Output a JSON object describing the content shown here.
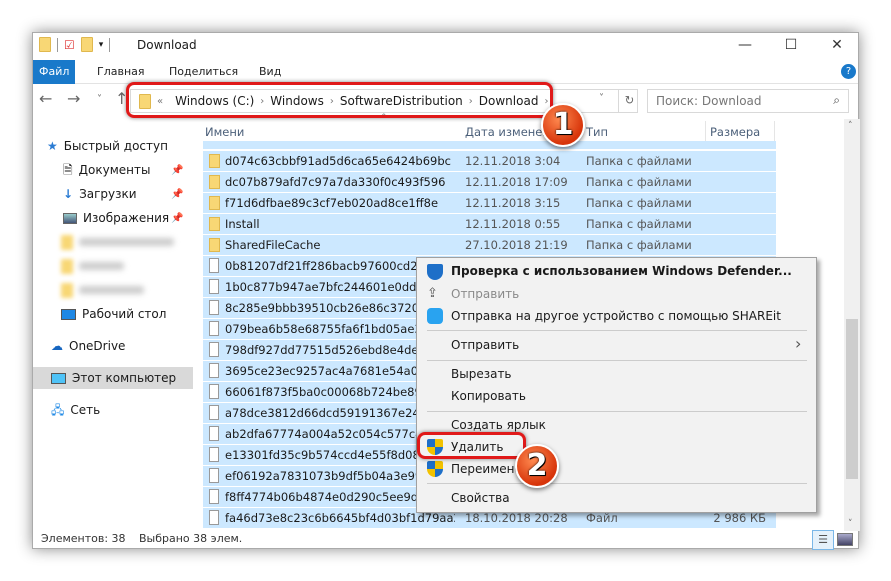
{
  "window": {
    "title": "Download",
    "minimize": "—",
    "maximize": "☐",
    "close": "✕"
  },
  "ribbon": {
    "tabs": [
      "Файл",
      "Главная",
      "Поделиться",
      "Вид"
    ],
    "help": "?"
  },
  "address": {
    "overflow": "«",
    "crumbs": [
      "Windows (C:)",
      "Windows",
      "SoftwareDistribution",
      "Download"
    ]
  },
  "search": {
    "placeholder": "Поиск: Download"
  },
  "sidebar": {
    "quick_access": "Быстрый доступ",
    "items": [
      {
        "label": "Документы",
        "icon": "documents-icon",
        "pinned": true
      },
      {
        "label": "Загрузки",
        "icon": "downloads-icon",
        "pinned": true
      },
      {
        "label": "Изображения",
        "icon": "pictures-icon",
        "pinned": true
      },
      {
        "label": "Рабочий стол",
        "icon": "desktop-icon"
      }
    ],
    "onedrive": "OneDrive",
    "this_pc": "Этот компьютер",
    "network": "Сеть"
  },
  "columns": {
    "name": "Имени",
    "date": "Дата изменения",
    "type": "Тип",
    "size": "Размера"
  },
  "files": [
    {
      "name": "d074c63cbbf91ad5d6ca65e6424b69bc",
      "date": "12.11.2018 3:04",
      "type": "Папка с файлами",
      "kind": "folder"
    },
    {
      "name": "dc07b879afd7c97a7da330f0c493f596",
      "date": "12.11.2018 17:09",
      "type": "Папка с файлами",
      "kind": "folder"
    },
    {
      "name": "f71d6dfbae89c3cf7eb020ad8ce1ff8e",
      "date": "12.11.2018 3:15",
      "type": "Папка с файлами",
      "kind": "folder"
    },
    {
      "name": "Install",
      "date": "12.11.2018 0:55",
      "type": "Папка с файлами",
      "kind": "folder"
    },
    {
      "name": "SharedFileCache",
      "date": "27.10.2018 21:19",
      "type": "Папка с файлами",
      "kind": "folder"
    },
    {
      "name": "0b81207df21ff286bacb97600cd28a7b",
      "kind": "file"
    },
    {
      "name": "1b0c877b947ae7bfc244601e0ddc1e0",
      "kind": "file"
    },
    {
      "name": "8c285e9bbb39510cb26e86c37201d7e",
      "kind": "file"
    },
    {
      "name": "079bea6b58e68755fa6f1bd05ae31f42",
      "kind": "file"
    },
    {
      "name": "798df927dd77515d526ebd8e4dedb81",
      "kind": "file"
    },
    {
      "name": "3695ce23ec9257ac4a7681e54a0d1d8",
      "kind": "file"
    },
    {
      "name": "66061f873f5ba0c00068b724be8972bb",
      "kind": "file"
    },
    {
      "name": "a78dce3812d66dcd59191367e24d171",
      "kind": "file"
    },
    {
      "name": "ab2dfa67774a004a52c054c577c4d6b",
      "kind": "file"
    },
    {
      "name": "e13301fd35c9b574ccd4e55f8d08894",
      "kind": "file"
    },
    {
      "name": "ef06192a7831073b9df5b04a3e99605a",
      "kind": "file"
    },
    {
      "name": "f8ff4774b06b4874e0d290c5ee9d4f4c",
      "kind": "file"
    },
    {
      "name": "fa46d73e8c23c6b6645bf4d03bf1d79aa268...",
      "date": "18.10.2018 20:28",
      "type": "Файл",
      "size": "2 986 КБ",
      "kind": "file"
    }
  ],
  "status": {
    "count": "Элементов: 38",
    "selected": "Выбрано 38 элем."
  },
  "context_menu": {
    "items": [
      {
        "label": "Проверка с использованием Windows Defender...",
        "icon": "defender-icon",
        "bold": true
      },
      {
        "label": "Отправить",
        "icon": "share-icon",
        "disabled": true
      },
      {
        "label": "Отправка на другое устройство с помощью SHAREit",
        "icon": "shareit-icon"
      },
      {
        "label": "Отправить",
        "submenu": true
      },
      {
        "label": "Вырезать"
      },
      {
        "label": "Копировать"
      },
      {
        "label": "Создать ярлык"
      },
      {
        "label": "Удалить",
        "icon": "uac-shield-icon",
        "highlighted": true
      },
      {
        "label": "Переименовать",
        "icon": "uac-shield-icon"
      },
      {
        "label": "Свойства"
      }
    ]
  },
  "annotations": {
    "step1": "1",
    "step2": "2",
    "highlight_color": "#e01919"
  }
}
